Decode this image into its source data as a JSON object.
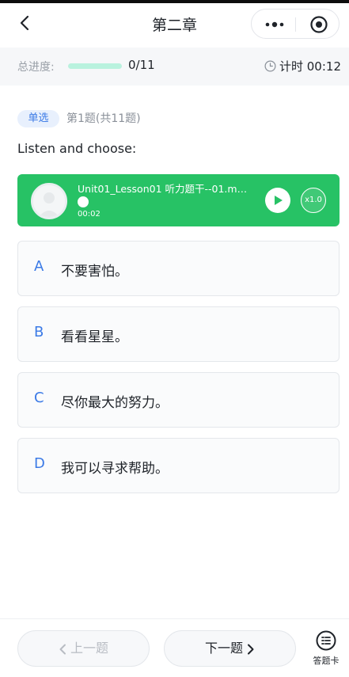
{
  "header": {
    "title": "第二章",
    "icons": [
      "back-arrow",
      "more-dots",
      "close-target"
    ]
  },
  "progress": {
    "label": "总进度:",
    "count": "0/11",
    "ratio": 0,
    "timer": "计时 00:12"
  },
  "question": {
    "type_badge": "单选",
    "index_text": "第1题(共11题)",
    "prompt": "Listen and choose:"
  },
  "audio": {
    "file_name": "Unit01_Lesson01 听力题干--01.m…",
    "elapsed": "00:02",
    "speed": "x1.0"
  },
  "options": [
    {
      "letter": "A",
      "text": "不要害怕。"
    },
    {
      "letter": "B",
      "text": "看看星星。"
    },
    {
      "letter": "C",
      "text": "尽你最大的努力。"
    },
    {
      "letter": "D",
      "text": "我可以寻求帮助。"
    }
  ],
  "footer": {
    "prev_label": "上一题",
    "next_label": "下一题",
    "sheet_label": "答题卡"
  },
  "colors": {
    "accent_blue": "#3b7ae6",
    "audio_green": "#27c265",
    "progress_fill": "#b9f2de"
  }
}
